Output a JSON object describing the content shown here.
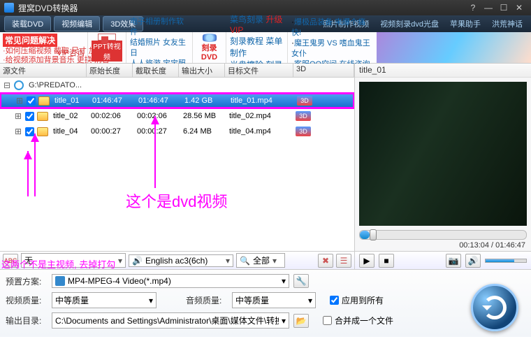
{
  "window": {
    "title": "狸窝DVD转换器"
  },
  "toolbar": {
    "load": "装载DVD",
    "edit": "视频编辑",
    "fx": "3D效果",
    "links": [
      "照片制作视频",
      "视频刻录dvd光盘",
      "苹果助手",
      "洪荒神话"
    ]
  },
  "banner": {
    "faq_title": "常见问题解决",
    "vip": "VIP咨询",
    "faq1": "·如何压缩视频 截取 尺寸 加速",
    "faq2": "·给视频添加背景音乐 更换 消音",
    "ppt": "PPT转视频",
    "grp1": [
      "电子相册制作软件",
      "结婚照片 女友生日",
      "人人旅游 宝宝照片"
    ],
    "dvd": "刻录DVD",
    "grp2": [
      [
        "菜鸟刻录",
        "升级",
        "VIP"
      ],
      [
        "刻录教程",
        "菜单制作"
      ],
      [
        "光盘擦除",
        "刻录照片"
      ]
    ],
    "grp3": [
      [
        "爆极品装备 来爆个痛快!"
      ],
      [
        "魔王鬼男 VS 嗜血鬼王女仆"
      ],
      [
        "客服QQ空间",
        "在线咨询"
      ]
    ]
  },
  "table": {
    "headers": {
      "src": "源文件",
      "orig": "原始长度",
      "clip": "截取长度",
      "size": "输出大小",
      "target": "目标文件",
      "td": "3D"
    },
    "root": "G:\\PREDATO...",
    "rows": [
      {
        "name": "title_01",
        "orig": "01:46:47",
        "clip": "01:46:47",
        "size": "1.42 GB",
        "target": "title_01.mp4",
        "checked": true,
        "sel": true
      },
      {
        "name": "title_02",
        "orig": "00:02:06",
        "clip": "00:02:06",
        "size": "28.56 MB",
        "target": "title_02.mp4",
        "checked": true,
        "sel": false
      },
      {
        "name": "title_04",
        "orig": "00:00:27",
        "clip": "00:00:27",
        "size": "6.24 MB",
        "target": "title_04.mp4",
        "checked": true,
        "sel": false
      }
    ]
  },
  "annotations": {
    "a1": "这两个不是主视频, 去掉打勾",
    "a2": "这个是dvd视频"
  },
  "leftbar": {
    "subtitle": "无",
    "audio": "English ac3(6ch)",
    "scope": "全部"
  },
  "preview": {
    "title": "title_01",
    "time": "00:13:04 / 01:46:47"
  },
  "bottom": {
    "preset_lbl": "预置方案:",
    "preset": "MP4-MPEG-4 Video(*.mp4)",
    "vq_lbl": "视频质量:",
    "vq": "中等质量",
    "aq_lbl": "音频质量:",
    "aq": "中等质量",
    "apply": "应用到所有",
    "out_lbl": "输出目录:",
    "out": "C:\\Documents and Settings\\Administrator\\桌面\\媒体文件\\转换后",
    "merge": "合并成一个文件"
  }
}
